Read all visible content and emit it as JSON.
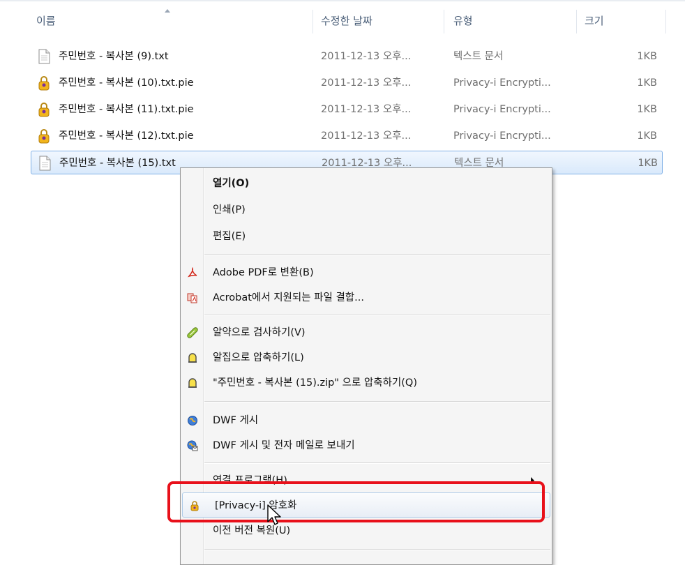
{
  "colors": {
    "accent_selection": "#d9e9fb",
    "highlight_border": "#e8101a",
    "header_text": "#4c607a"
  },
  "columns": {
    "name": "이름",
    "date": "수정한 날짜",
    "type": "유형",
    "size": "크기"
  },
  "files": [
    {
      "name": "주민번호 - 복사본 (9).txt",
      "date": "2011-12-13 오후...",
      "type": "텍스트 문서",
      "size": "1KB",
      "icon": "text-file-icon"
    },
    {
      "name": "주민번호 - 복사본 (10).txt.pie",
      "date": "2011-12-13 오후...",
      "type": "Privacy-i Encrypti...",
      "size": "1KB",
      "icon": "lock-file-icon"
    },
    {
      "name": "주민번호 - 복사본 (11).txt.pie",
      "date": "2011-12-13 오후...",
      "type": "Privacy-i Encrypti...",
      "size": "1KB",
      "icon": "lock-file-icon"
    },
    {
      "name": "주민번호 - 복사본 (12).txt.pie",
      "date": "2011-12-13 오후...",
      "type": "Privacy-i Encrypti...",
      "size": "1KB",
      "icon": "lock-file-icon"
    },
    {
      "name": "주민번호 - 복사본 (15).txt",
      "date": "2011-12-13 오후...",
      "type": "텍스트 문서",
      "size": "1KB",
      "icon": "text-file-icon",
      "selected": true
    }
  ],
  "context_menu": {
    "open": "열기(O)",
    "print": "인쇄(P)",
    "edit": "편집(E)",
    "adobe_convert": "Adobe PDF로 변환(B)",
    "acrobat_combine": "Acrobat에서 지원되는 파일 결합...",
    "alyac_scan": "알약으로 검사하기(V)",
    "alzip_compress": "알집으로 압축하기(L)",
    "alzip_compress_named": "\"주민번호 - 복사본 (15).zip\" 으로 압축하기(Q)",
    "dwf_publish": "DWF 게시",
    "dwf_publish_email": "DWF 게시 및 전자 메일로 보내기",
    "open_with": "연결 프로그램(H)",
    "privacy_encrypt": "[Privacy-i] 암호화",
    "restore_previous": "이전 버전 복원(U)"
  }
}
